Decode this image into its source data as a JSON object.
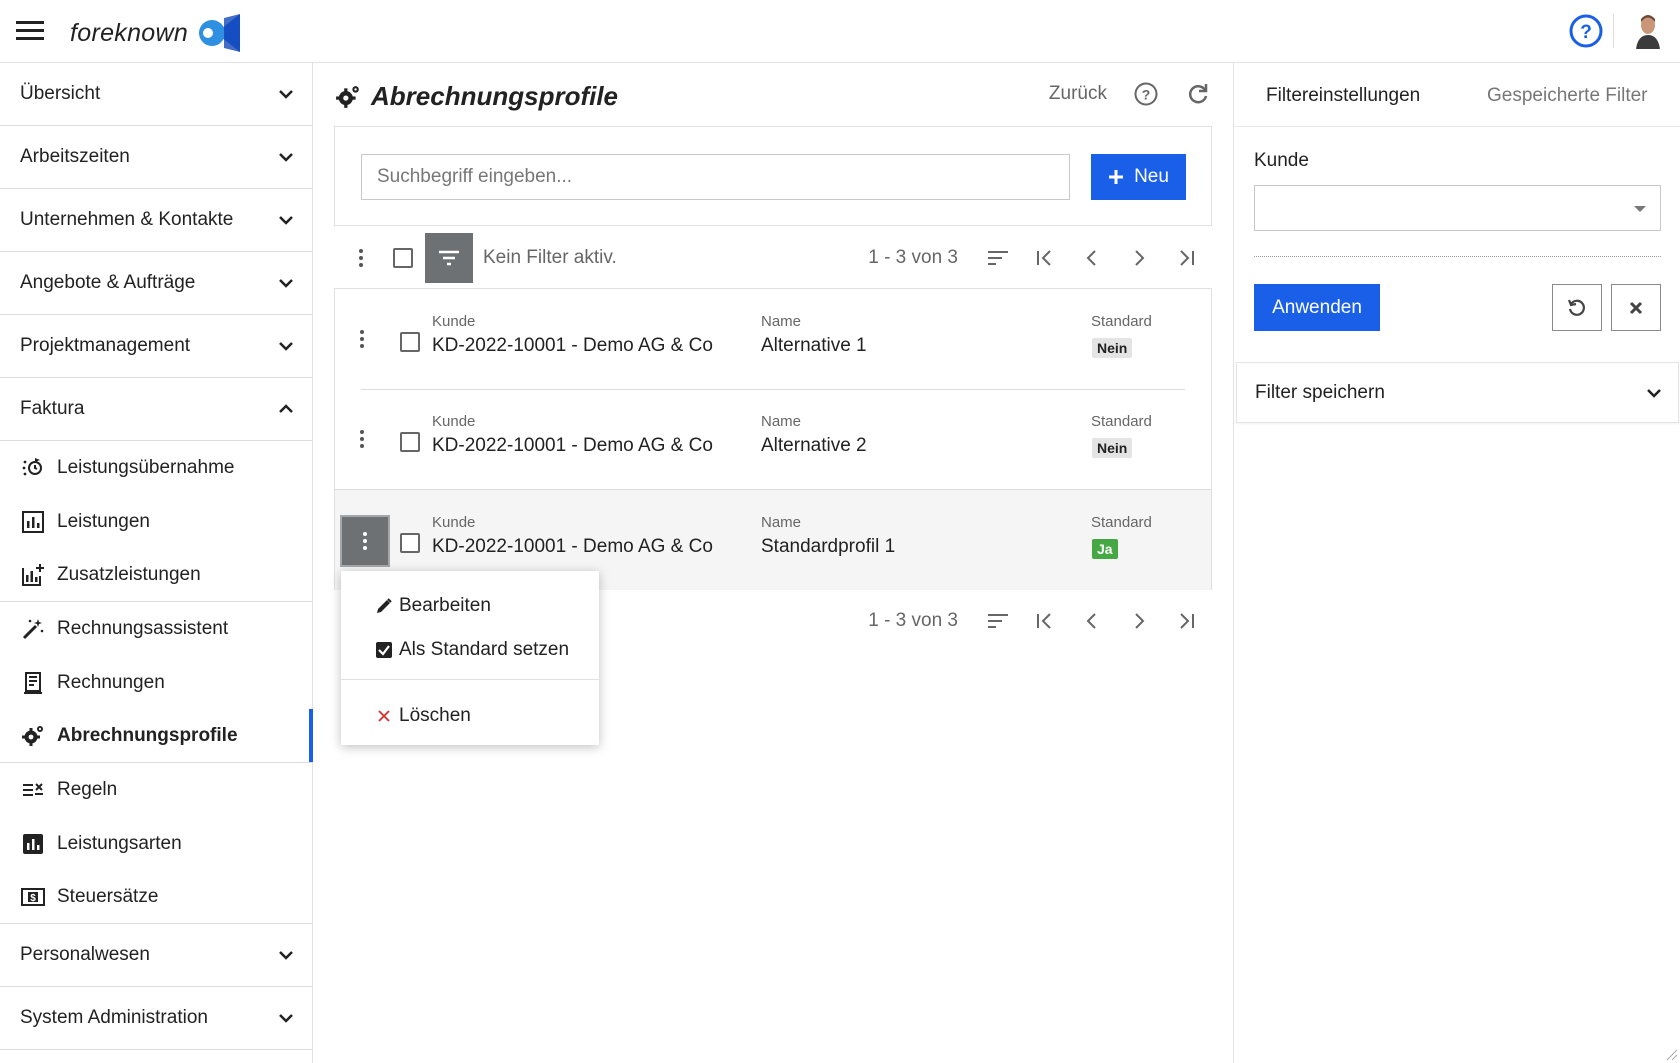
{
  "app": {
    "logo_text": "foreknown"
  },
  "sidebar": {
    "sections": [
      {
        "label": "Übersicht"
      },
      {
        "label": "Arbeitszeiten"
      },
      {
        "label": "Unternehmen & Kontakte"
      },
      {
        "label": "Angebote & Aufträge"
      },
      {
        "label": "Projektmanagement"
      },
      {
        "label": "Faktura"
      }
    ],
    "faktura_items": [
      {
        "label": "Leistungsübernahme",
        "icon": "transfer-icon"
      },
      {
        "label": "Leistungen",
        "icon": "chart-icon"
      },
      {
        "label": "Zusatzleistungen",
        "icon": "chart-plus-icon"
      },
      {
        "label": "Rechnungsassistent",
        "icon": "magic-wand-icon"
      },
      {
        "label": "Rechnungen",
        "icon": "receipt-icon"
      },
      {
        "label": "Abrechnungsprofile",
        "icon": "gear-icon",
        "active": true
      },
      {
        "label": "Regeln",
        "icon": "rules-icon"
      },
      {
        "label": "Leistungsarten",
        "icon": "bar-chart-icon"
      },
      {
        "label": "Steuersätze",
        "icon": "dollar-box-icon"
      }
    ],
    "bottom_sections": [
      {
        "label": "Personalwesen"
      },
      {
        "label": "System Administration"
      }
    ]
  },
  "main": {
    "title": "Abrechnungsprofile",
    "back_label": "Zurück",
    "search_placeholder": "Suchbegriff eingeben...",
    "new_label": "Neu",
    "filter_status": "Kein Filter aktiv.",
    "page_count": "1 - 3 von 3",
    "columns": {
      "kunde": "Kunde",
      "name": "Name",
      "standard": "Standard"
    },
    "rows": [
      {
        "kunde": "KD-2022-10001 - Demo AG & Co",
        "name": "Alternative 1",
        "standard": "Nein"
      },
      {
        "kunde": "KD-2022-10001 - Demo AG & Co",
        "name": "Alternative 2",
        "standard": "Nein"
      },
      {
        "kunde": "KD-2022-10001 - Demo AG & Co",
        "name": "Standardprofil 1",
        "standard": "Ja"
      }
    ]
  },
  "context_menu": {
    "edit": "Bearbeiten",
    "set_default": "Als Standard setzen",
    "delete": "Löschen"
  },
  "filter_panel": {
    "tab_settings": "Filtereinstellungen",
    "tab_saved": "Gespeicherte Filter",
    "kunde_label": "Kunde",
    "kunde_value": "",
    "apply": "Anwenden",
    "save_filter": "Filter speichern"
  },
  "colors": {
    "accent": "#1a5fe8",
    "badge_yes": "#45a843",
    "badge_no": "#e4e4e4"
  }
}
